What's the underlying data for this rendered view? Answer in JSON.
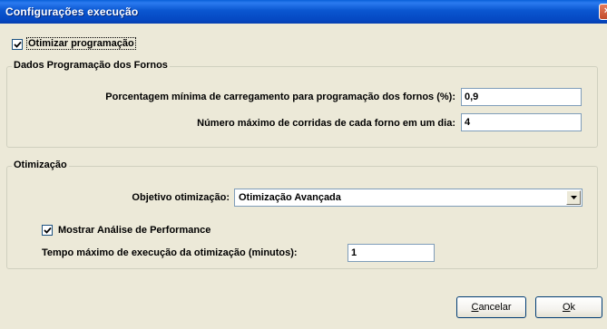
{
  "window": {
    "title": "Configurações execução",
    "close_glyph": "×"
  },
  "optimize": {
    "label": "Otimizar programação",
    "checked": true
  },
  "dados": {
    "legend": "Dados Programação dos Fornos",
    "pct_label": "Porcentagem mínima de carregamento para programação dos fornos (%):",
    "pct_value": "0,9",
    "max_label": "Número máximo de corridas de cada forno em um dia:",
    "max_value": "4"
  },
  "otimizacao": {
    "legend": "Otimização",
    "objetivo_label": "Objetivo otimização:",
    "objetivo_value": "Otimização Avançada",
    "perf_label": "Mostrar Análise de Performance",
    "perf_checked": true,
    "tempo_label": "Tempo máximo de execução da otimização (minutos):",
    "tempo_value": "1"
  },
  "buttons": {
    "cancel_key": "C",
    "cancel_rest": "ancelar",
    "ok_key": "O",
    "ok_rest": "k"
  },
  "icons": {
    "close": "close-icon",
    "check": "checkmark-icon",
    "dropdown": "chevron-down-icon"
  }
}
